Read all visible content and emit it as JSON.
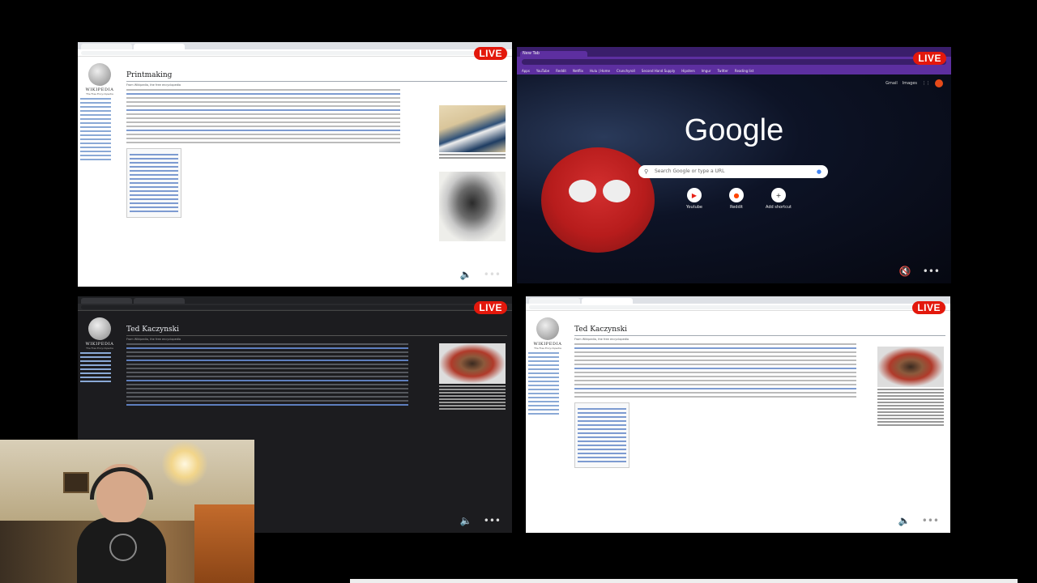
{
  "tiles": {
    "top_left": {
      "live": "LIVE",
      "wiki_word": "WIKIPEDIA",
      "wiki_tag": "The Free Encyclopedia",
      "title": "Printmaking",
      "subtitle": "From Wikipedia, the free encyclopedia"
    },
    "top_right": {
      "live": "LIVE",
      "tab": "New Tab",
      "bookmarks": [
        "Apps",
        "YouTube",
        "Reddit",
        "Netflix",
        "Hulu | Home",
        "Crunchyroll",
        "Second Hand Supply",
        "Hipsters",
        "Imgur",
        "Twitter",
        "Reading list"
      ],
      "top_links": [
        "Gmail",
        "Images"
      ],
      "logo": "Google",
      "search_placeholder": "Search Google or type a URL",
      "shortcuts": [
        {
          "label": "Youtube",
          "icon": "youtube-icon"
        },
        {
          "label": "Reddit",
          "icon": "reddit-icon"
        },
        {
          "label": "Add shortcut",
          "icon": "plus-icon"
        }
      ]
    },
    "bottom_left": {
      "live": "LIVE",
      "wiki_word": "WIKIPEDIA",
      "wiki_tag": "The Free Encyclopedia",
      "title": "Ted Kaczynski",
      "subtitle": "From Wikipedia, the free encyclopedia"
    },
    "bottom_right": {
      "live": "LIVE",
      "wiki_word": "WIKIPEDIA",
      "wiki_tag": "The Free Encyclopedia",
      "title": "Ted Kaczynski",
      "subtitle": "From Wikipedia, the free encyclopedia"
    }
  },
  "colors": {
    "live": "#e3180c",
    "chrome_purple": "#5d2fa0"
  }
}
